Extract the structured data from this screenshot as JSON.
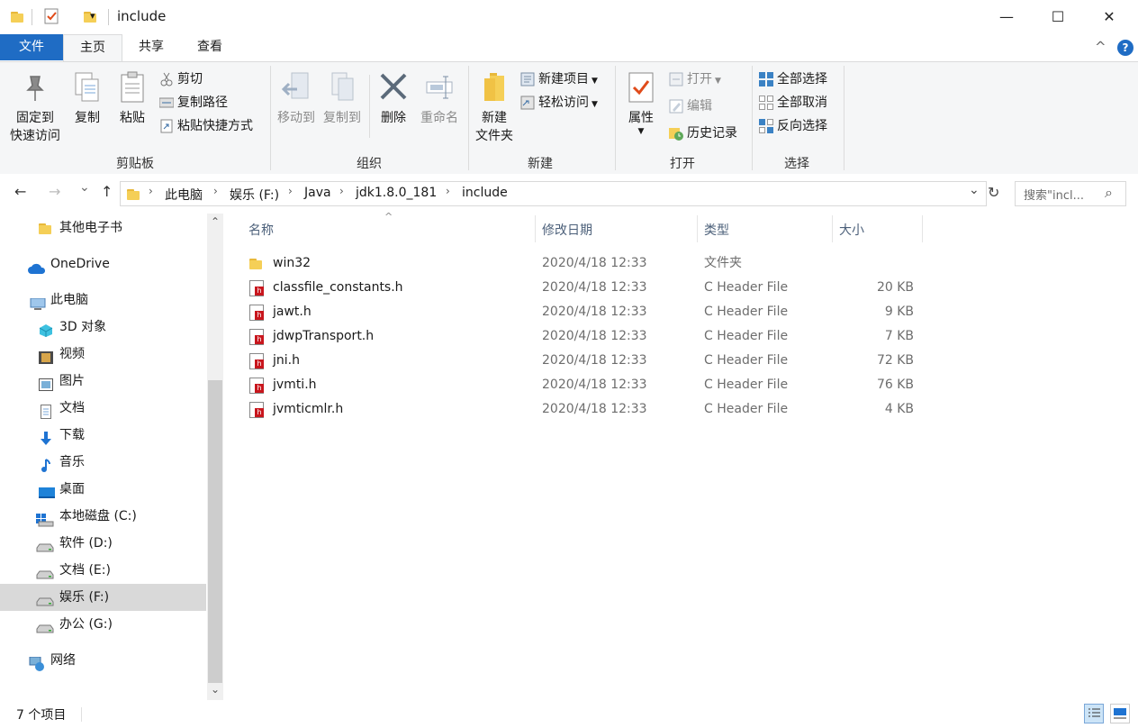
{
  "window": {
    "title": "include",
    "minimize_icon": "—",
    "maximize_icon": "☐",
    "close_icon": "✕",
    "qat_dropdown_icon": "▾"
  },
  "tabs": [
    {
      "label": "文件"
    },
    {
      "label": "主页"
    },
    {
      "label": "共享"
    },
    {
      "label": "查看"
    }
  ],
  "ribbon": {
    "collapse_icon": "^",
    "help_icon": "?",
    "clipboard": {
      "group_label": "剪贴板",
      "pin_label_1": "固定到",
      "pin_label_2": "快速访问",
      "copy_label": "复制",
      "paste_label": "粘贴",
      "cut_label": "剪切",
      "copy_path_label": "复制路径",
      "paste_shortcut_label": "粘贴快捷方式"
    },
    "organize": {
      "group_label": "组织",
      "move_to_label": "移动到",
      "copy_to_label": "复制到",
      "delete_label": "删除",
      "rename_label": "重命名"
    },
    "new": {
      "group_label": "新建",
      "new_folder_label_1": "新建",
      "new_folder_label_2": "文件夹",
      "new_item_label": "新建项目",
      "easy_access_label": "轻松访问"
    },
    "open": {
      "group_label": "打开",
      "properties_label": "属性",
      "open_label": "打开",
      "edit_label": "编辑",
      "history_label": "历史记录"
    },
    "select": {
      "group_label": "选择",
      "select_all_label": "全部选择",
      "select_none_label": "全部取消",
      "invert_label": "反向选择"
    }
  },
  "nav": {
    "back_icon": "←",
    "forward_icon": "→",
    "recent_icon": "⌄",
    "up_icon": "↑",
    "breadcrumb": [
      "此电脑",
      "娱乐 (F:)",
      "Java",
      "jdk1.8.0_181",
      "include"
    ],
    "breadcrumb_sep": "›",
    "dropdown_icon": "⌄",
    "refresh_icon": "↻",
    "search_placeholder": "搜索\"incl...",
    "search_icon": "⌕"
  },
  "sidebar": {
    "items": [
      {
        "label": "其他电子书",
        "icon": "folder-icon"
      },
      {
        "label": "OneDrive",
        "icon": "cloud-icon"
      },
      {
        "label": "此电脑",
        "icon": "computer-icon"
      },
      {
        "label": "3D 对象",
        "icon": "3d-objects-icon"
      },
      {
        "label": "视频",
        "icon": "video-icon"
      },
      {
        "label": "图片",
        "icon": "pictures-icon"
      },
      {
        "label": "文档",
        "icon": "documents-icon"
      },
      {
        "label": "下载",
        "icon": "download-icon"
      },
      {
        "label": "音乐",
        "icon": "music-icon"
      },
      {
        "label": "桌面",
        "icon": "desktop-icon"
      },
      {
        "label": "本地磁盘 (C:)",
        "icon": "system-drive-icon"
      },
      {
        "label": "软件 (D:)",
        "icon": "drive-icon"
      },
      {
        "label": "文档 (E:)",
        "icon": "drive-icon"
      },
      {
        "label": "娱乐 (F:)",
        "icon": "drive-icon"
      },
      {
        "label": "办公 (G:)",
        "icon": "drive-icon"
      },
      {
        "label": "网络",
        "icon": "network-icon"
      }
    ],
    "selected": "娱乐 (F:)",
    "scroll_up_icon": "⌃",
    "scroll_down_icon": "⌄"
  },
  "files": {
    "sort_indicator": "^",
    "columns": [
      "名称",
      "修改日期",
      "类型",
      "大小"
    ],
    "rows": [
      {
        "name": "win32",
        "date": "2020/4/18 12:33",
        "type": "文件夹",
        "size": "",
        "icon": "folder-icon"
      },
      {
        "name": "classfile_constants.h",
        "date": "2020/4/18 12:33",
        "type": "C Header File",
        "size": "20 KB",
        "icon": "header-file-icon"
      },
      {
        "name": "jawt.h",
        "date": "2020/4/18 12:33",
        "type": "C Header File",
        "size": "9 KB",
        "icon": "header-file-icon"
      },
      {
        "name": "jdwpTransport.h",
        "date": "2020/4/18 12:33",
        "type": "C Header File",
        "size": "7 KB",
        "icon": "header-file-icon"
      },
      {
        "name": "jni.h",
        "date": "2020/4/18 12:33",
        "type": "C Header File",
        "size": "72 KB",
        "icon": "header-file-icon"
      },
      {
        "name": "jvmti.h",
        "date": "2020/4/18 12:33",
        "type": "C Header File",
        "size": "76 KB",
        "icon": "header-file-icon"
      },
      {
        "name": "jvmticmlr.h",
        "date": "2020/4/18 12:33",
        "type": "C Header File",
        "size": "4 KB",
        "icon": "header-file-icon"
      }
    ]
  },
  "status": {
    "item_count": "7 个项目"
  },
  "colors": {
    "accent": "#1f6cc4",
    "folder": "#f5cf57",
    "selection": "#d9d9d9",
    "header_icon_red": "#c8161d"
  }
}
